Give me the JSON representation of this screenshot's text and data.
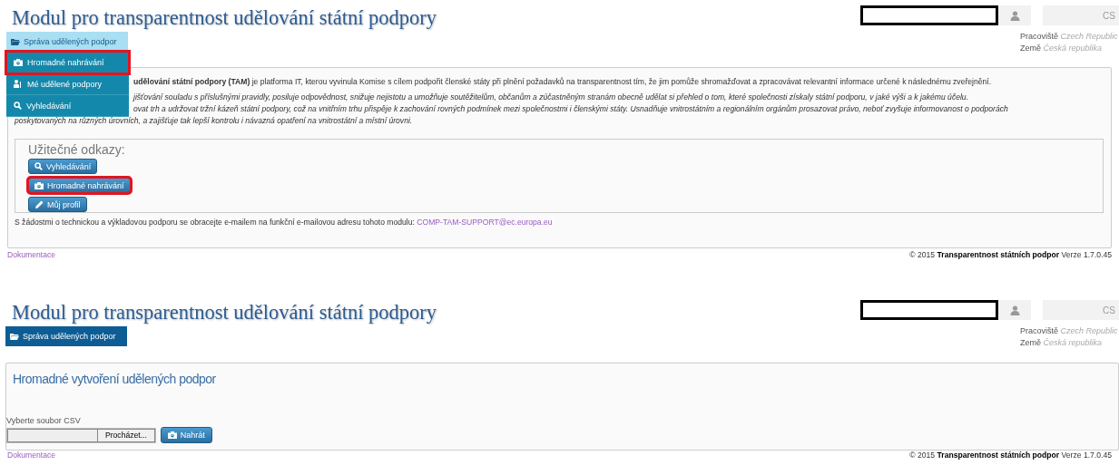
{
  "screens": [
    {
      "kind": "home",
      "header": {
        "title": "Modul pro transparentnost udělování státní podpory",
        "language": "CS",
        "workplace_label": "Pracoviště",
        "workplace": "Czech Republic",
        "country_label": "Země",
        "country": "Česká republika"
      },
      "menu": {
        "label": "Správa udělených podpor",
        "expanded": true,
        "items": [
          {
            "label": "Hromadné nahrávání",
            "highlighted": true
          },
          {
            "label": "Mé udělené podpory",
            "highlighted": false
          },
          {
            "label": "Vyhledávání",
            "highlighted": false
          }
        ]
      },
      "intro": [
        {
          "kind": "covered",
          "italic": false,
          "text": "**udělování státní podpory (TAM)** je platforma IT, kterou vyvinula Komise s cílem podpořit členské státy při plnění požadavků na transparentnost tím, že jim pomůže shromažďovat a zpracovávat relevantní informace určené k následnému zveřejnění."
        },
        {
          "kind": "covered",
          "italic": true,
          "text": "jišťování souladu s příslušnými pravidly, posiluje odpovědnost, snižuje nejistotu a umožňuje soutěžitelům, občanům a zúčastněným stranám obecně udělat si přehled o tom, které společnosti získaly státní podporu, v jaké výši a k jakému účelu."
        },
        {
          "kind": "covered",
          "italic": true,
          "text": "ovat trh a udržovat tržní kázeň státní podpory, což na vnitřním trhu přispěje k zachování rovných podmínek mezi společnostmi i členskými státy. Usnadňuje vnitrostátním a regionálním orgánům prosazovat právo, neboť zvyšuje informovanost o podporách"
        },
        {
          "kind": "full",
          "italic": true,
          "text": "poskytovaných na různých úrovních, a zajišťuje tak lepší kontrolu i návazná opatření na vnitrostátní a místní úrovni."
        }
      ],
      "useful_links": {
        "title": "Užitečné odkazy:",
        "links": [
          {
            "label": "Vyhledávání",
            "highlighted": false
          },
          {
            "label": "Hromadné nahrávání",
            "highlighted": true
          },
          {
            "label": "Můj profil",
            "highlighted": false
          }
        ]
      },
      "support": {
        "text": "S žádostmi o technickou a výkladovou podporu se obracejte e-mailem na funkční e-mailovou adresu tohoto modulu:",
        "email": "COMP-TAM-SUPPORT@ec.europa.eu"
      },
      "footer": {
        "link": "Dokumentace",
        "copyright": "© 2015 **Transparentnost státních podpor** Verze 1.7.0.45"
      }
    },
    {
      "kind": "upload",
      "header": {
        "title": "Modul pro transparentnost udělování státní podpory",
        "language": "CS",
        "workplace_label": "Pracoviště",
        "workplace": "Czech Republic",
        "country_label": "Země",
        "country": "Česká republika"
      },
      "menu": {
        "label": "Správa udělených podpor",
        "expanded": false
      },
      "form": {
        "title": "Hromadné vytvoření udělených podpor",
        "file_label": "Vyberte soubor CSV",
        "browse": "Procházet...",
        "upload": "Nahrát"
      },
      "footer": {
        "link": "Dokumentace",
        "copyright": "© 2015 **Transparentnost státních podpor** Verze 1.7.0.45"
      }
    }
  ]
}
